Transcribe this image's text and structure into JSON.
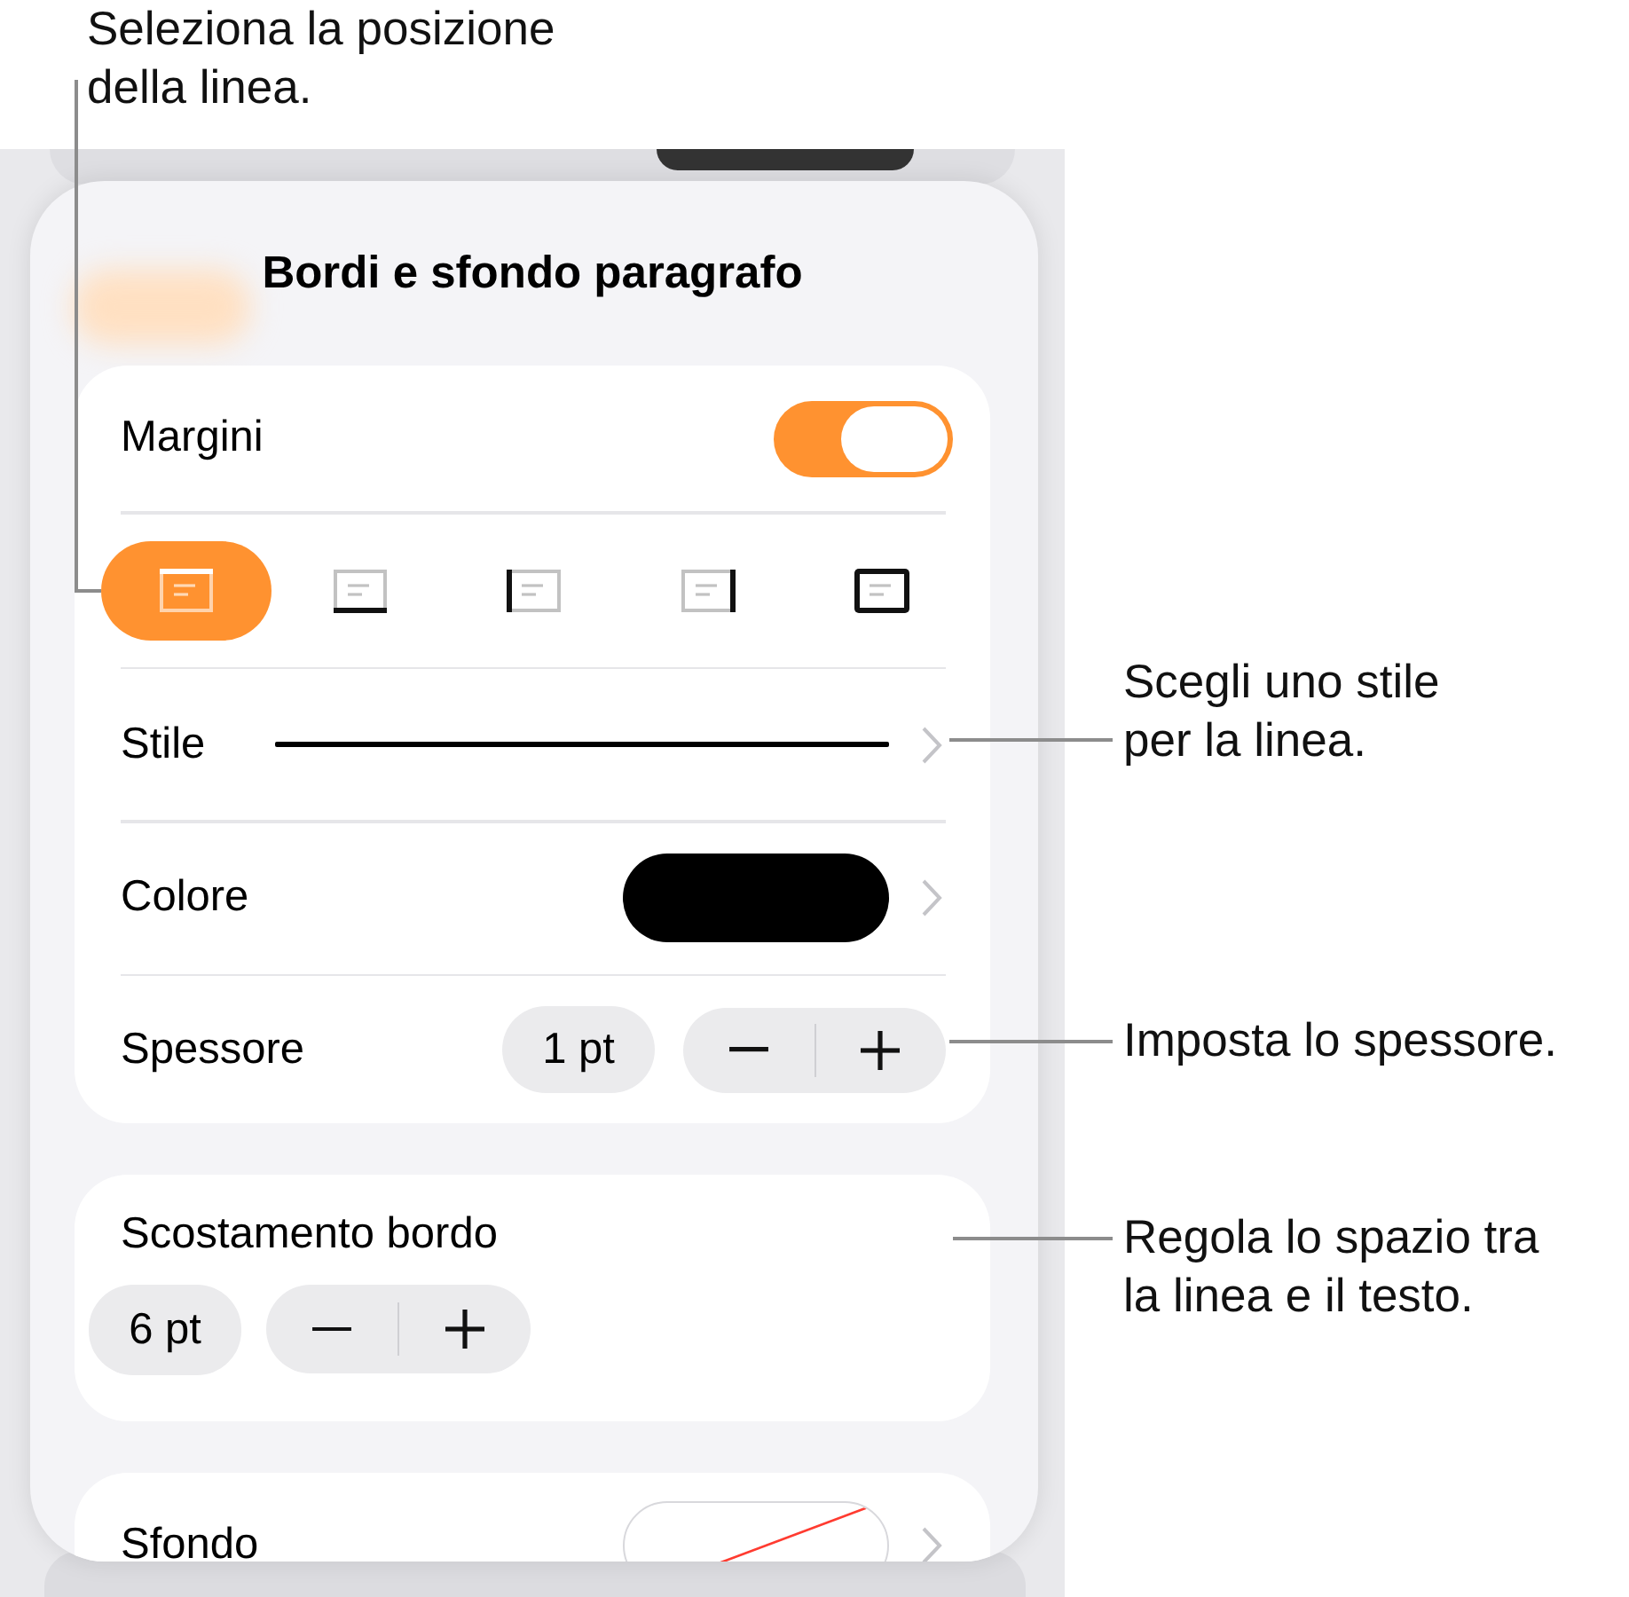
{
  "callouts": [
    {
      "text": "Seleziona la posizione\ndella linea."
    },
    {
      "text": "Scegli uno stile\nper la linea."
    },
    {
      "text": "Imposta lo spessore."
    },
    {
      "text": "Regola lo spazio tra\nla linea e il testo."
    }
  ],
  "panel": {
    "title": "Bordi e sfondo paragrafo",
    "sections": [
      {
        "rows": [
          {
            "kind": "toggle",
            "label": "Margini",
            "on": true
          },
          {
            "kind": "positions",
            "options": [
              {
                "kind": "top",
                "selected": true
              },
              {
                "kind": "bottom",
                "selected": false
              },
              {
                "kind": "left",
                "selected": false
              },
              {
                "kind": "right",
                "selected": false
              },
              {
                "kind": "all",
                "selected": false
              }
            ]
          },
          {
            "kind": "line",
            "label": "Stile"
          },
          {
            "kind": "swatch",
            "label": "Colore",
            "color": "#000000"
          },
          {
            "kind": "stepper",
            "label": "Spessore",
            "value": "1 pt"
          }
        ]
      },
      {
        "rows": [
          {
            "kind": "stepper-below",
            "label": "Scostamento bordo",
            "value": "6 pt"
          }
        ]
      },
      {
        "rows": [
          {
            "kind": "no-fill",
            "label": "Sfondo"
          }
        ]
      }
    ]
  }
}
